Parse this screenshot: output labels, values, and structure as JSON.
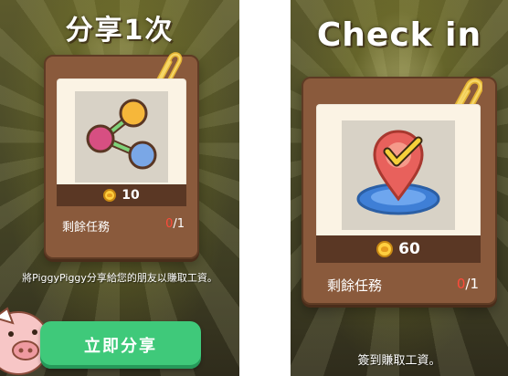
{
  "left": {
    "title": "分享1次",
    "reward_amount": "10",
    "remaining_label": "剩餘任務",
    "remaining_current": "0",
    "remaining_total": "/1",
    "description": "將PiggyPiggy分享給您的朋友以賺取工資。",
    "button_label": "立即分享",
    "icon": "share-icon"
  },
  "right": {
    "title": "Check in",
    "reward_amount": "60",
    "remaining_label": "剩餘任務",
    "remaining_current": "0",
    "remaining_total": "/1",
    "description": "簽到賺取工資。",
    "icon": "location-check-icon"
  },
  "colors": {
    "card": "#8a5a3c",
    "paper": "#fbf3e4",
    "button": "#3fc97a",
    "remaining_current": "#ff4a3a"
  }
}
